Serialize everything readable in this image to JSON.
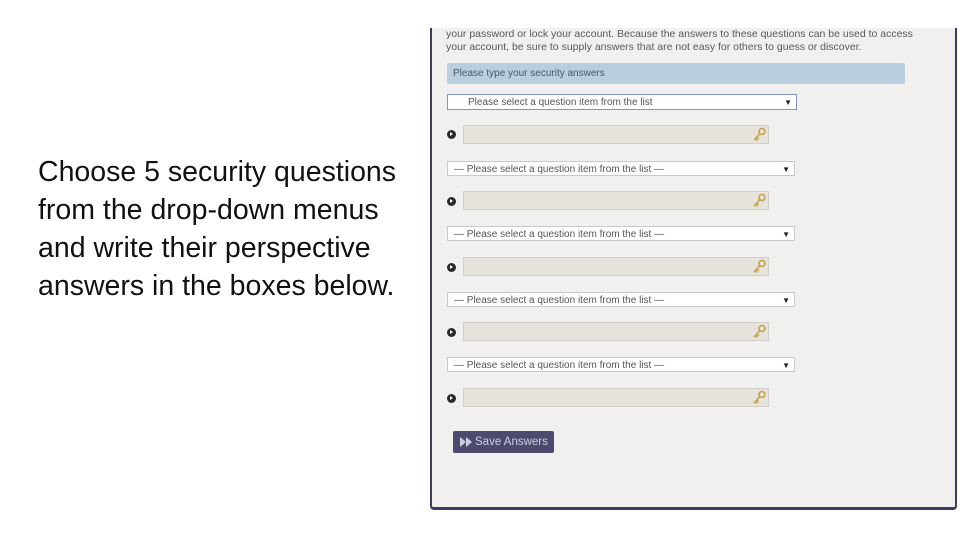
{
  "instruction": "Choose 5 security questions from the drop-down menus and write their perspective answers in the boxes below.",
  "panel": {
    "intro_line1": "your password or lock your account. Because the answers to these questions can be used to access",
    "intro_line2": "your account, be sure to supply answers that are not easy for others to guess or discover.",
    "section_header": "Please type your security answers",
    "questions": [
      {
        "selected": "Please select a question item from the list",
        "answer": "",
        "answer_icon": "key-icon"
      },
      {
        "selected": "— Please select a question item from the list —",
        "answer": "",
        "answer_icon": "key-icon"
      },
      {
        "selected": "— Please select a question item from the list —",
        "answer": "",
        "answer_icon": "key-icon"
      },
      {
        "selected": "— Please select a question item from the list —",
        "answer": "",
        "answer_icon": "key-icon"
      },
      {
        "selected": "— Please select a question item from the list —",
        "answer": "",
        "answer_icon": "key-icon"
      }
    ],
    "save_button": {
      "label": "Save Answers",
      "icon": "fast-forward-icon"
    }
  },
  "colors": {
    "panel_border": "#3d3b64",
    "panel_background": "#f1f0ef",
    "header_background": "#b9cede",
    "button_background": "#4d4a70",
    "answer_background": "#e6e3dc"
  }
}
